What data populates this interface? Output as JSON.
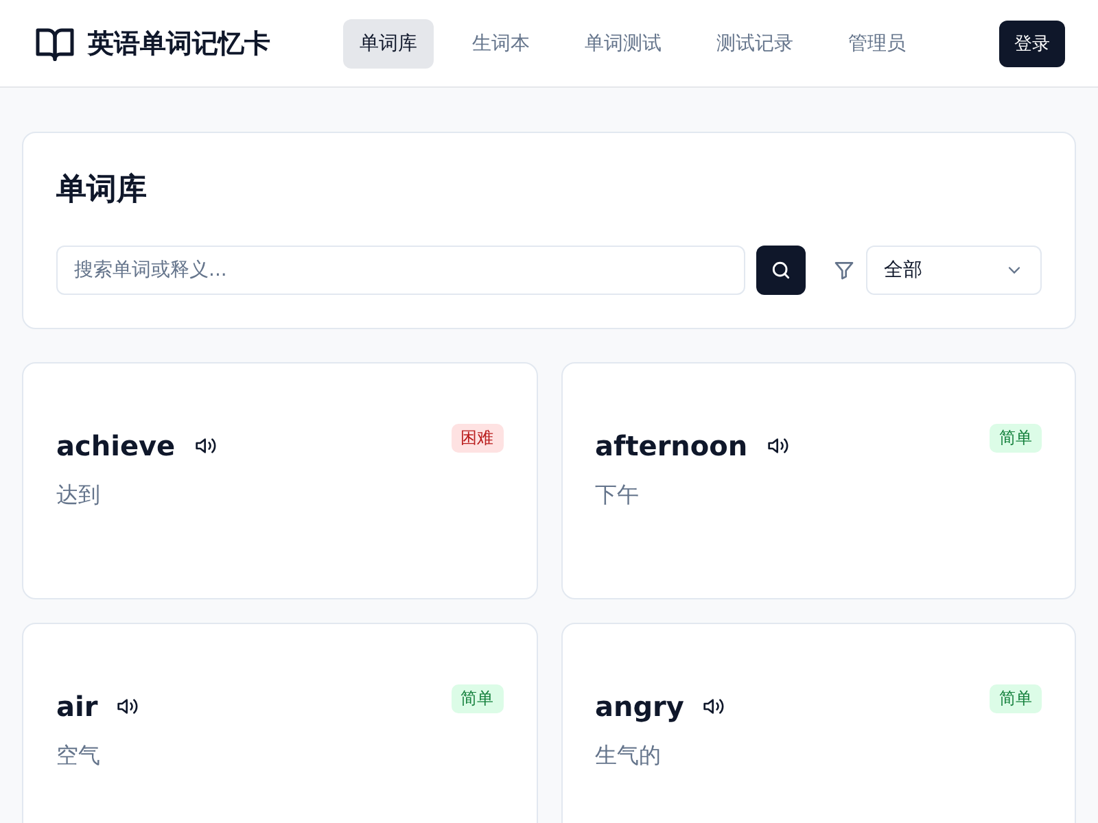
{
  "header": {
    "title": "英语单词记忆卡",
    "nav": [
      {
        "label": "单词库",
        "selected": true
      },
      {
        "label": "生词本",
        "selected": false
      },
      {
        "label": "单词测试",
        "selected": false
      },
      {
        "label": "测试记录",
        "selected": false
      },
      {
        "label": "管理员",
        "selected": false
      }
    ],
    "login": "登录"
  },
  "library": {
    "title": "单词库",
    "search": {
      "placeholder": "搜索单词或释义..."
    },
    "filter": {
      "value": "全部"
    }
  },
  "words": [
    {
      "word": "achieve",
      "meaning": "达到",
      "difficulty": "困难",
      "kind": "hard"
    },
    {
      "word": "afternoon",
      "meaning": "下午",
      "difficulty": "简单",
      "kind": "easy"
    },
    {
      "word": "air",
      "meaning": "空气",
      "difficulty": "简单",
      "kind": "easy"
    },
    {
      "word": "angry",
      "meaning": "生气的",
      "difficulty": "简单",
      "kind": "easy"
    }
  ]
}
